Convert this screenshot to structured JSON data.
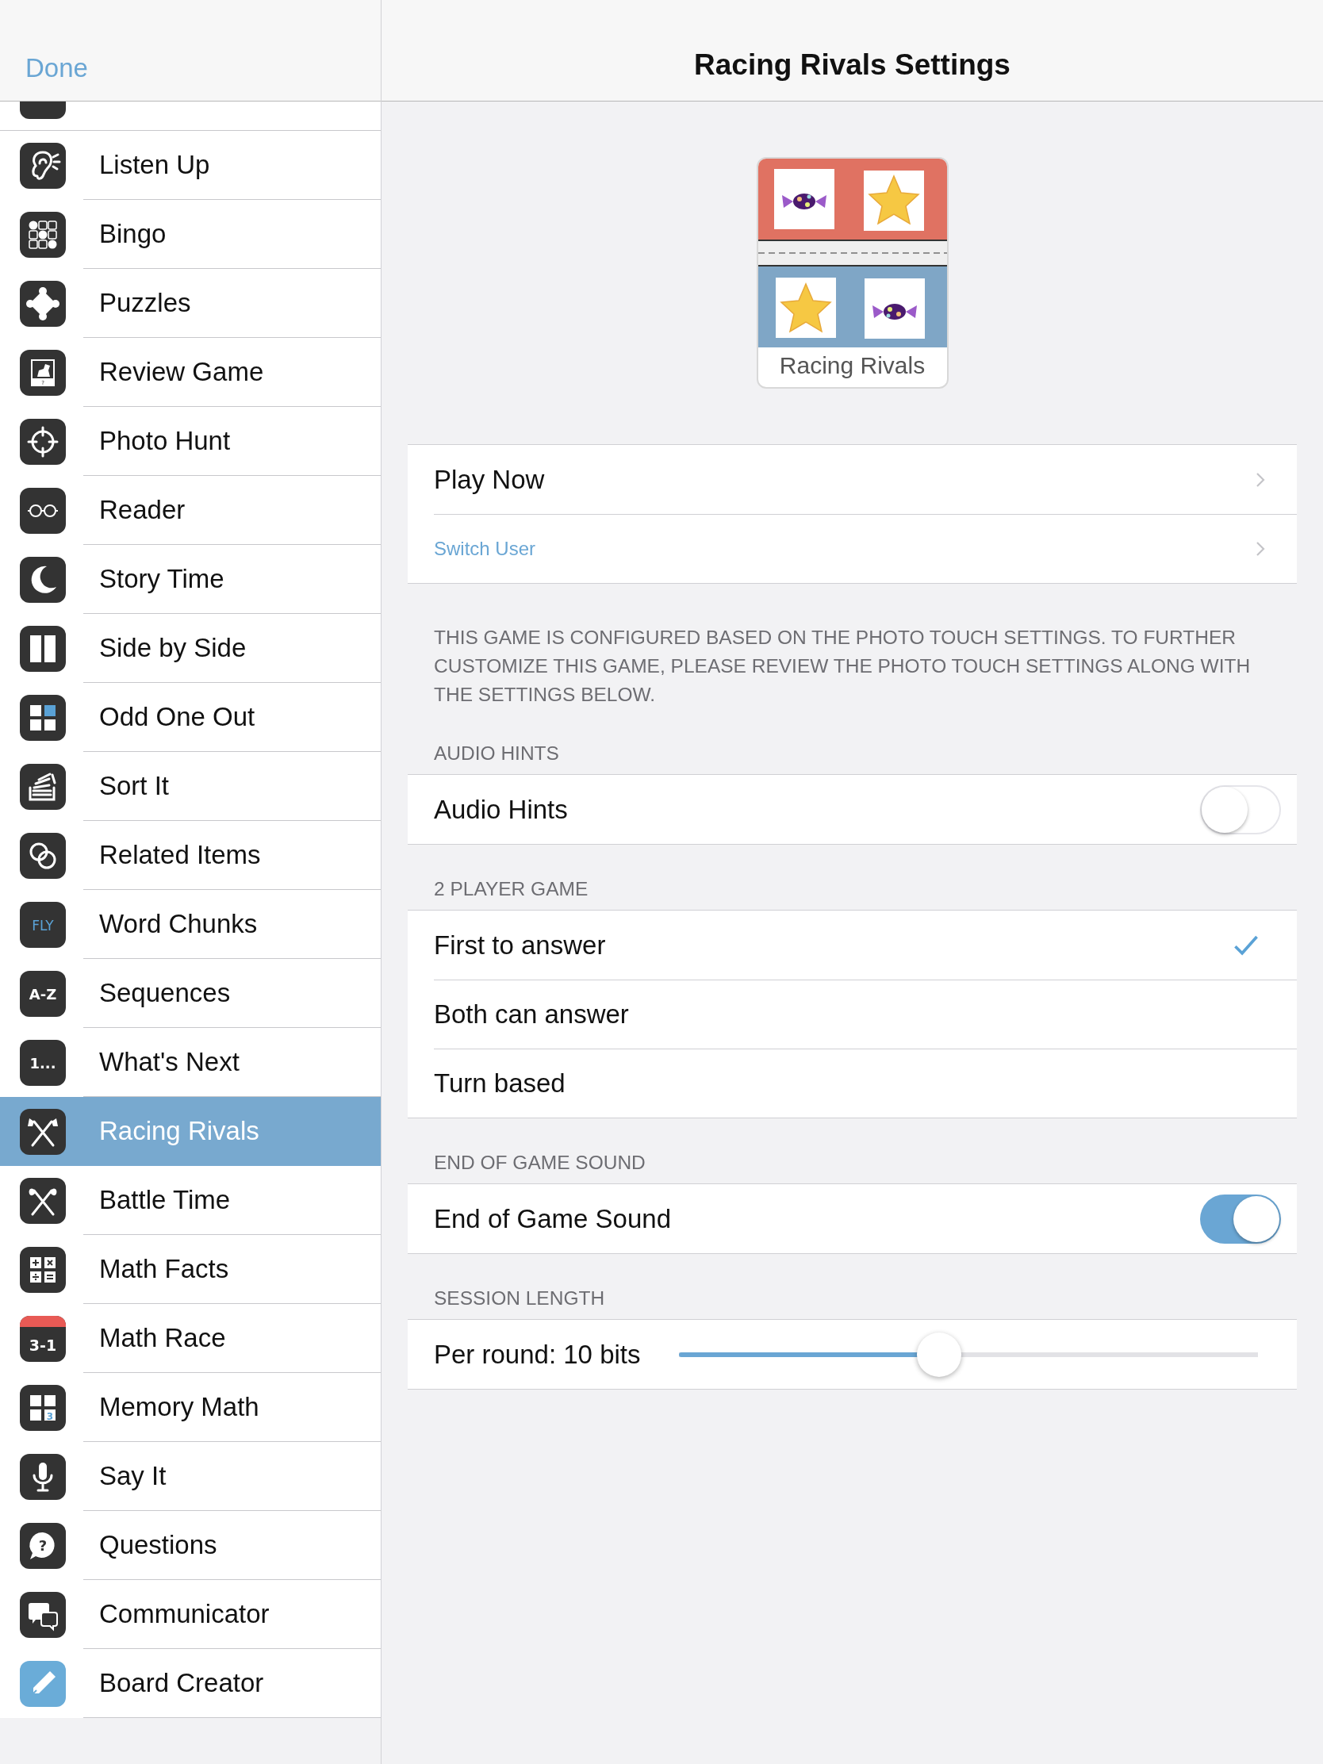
{
  "sidebar": {
    "done_button": "Done",
    "items": [
      {
        "label": "Listen Up",
        "selected": false
      },
      {
        "label": "Bingo",
        "selected": false
      },
      {
        "label": "Puzzles",
        "selected": false
      },
      {
        "label": "Review Game",
        "selected": false,
        "icon_text": "?"
      },
      {
        "label": "Photo Hunt",
        "selected": false
      },
      {
        "label": "Reader",
        "selected": false
      },
      {
        "label": "Story Time",
        "selected": false
      },
      {
        "label": "Side by Side",
        "selected": false
      },
      {
        "label": "Odd One Out",
        "selected": false
      },
      {
        "label": "Sort It",
        "selected": false
      },
      {
        "label": "Related Items",
        "selected": false
      },
      {
        "label": "Word Chunks",
        "selected": false,
        "icon_text": "FLY"
      },
      {
        "label": "Sequences",
        "selected": false,
        "icon_text": "A-Z"
      },
      {
        "label": "What's Next",
        "selected": false,
        "icon_text": "1..."
      },
      {
        "label": "Racing Rivals",
        "selected": true
      },
      {
        "label": "Battle Time",
        "selected": false
      },
      {
        "label": "Math Facts",
        "selected": false
      },
      {
        "label": "Math Race",
        "selected": false,
        "icon_text": "3-1"
      },
      {
        "label": "Memory Math",
        "selected": false,
        "icon_text": "3"
      },
      {
        "label": "Say It",
        "selected": false
      },
      {
        "label": "Questions",
        "selected": false,
        "icon_text": "?"
      },
      {
        "label": "Communicator",
        "selected": false
      },
      {
        "label": "Board Creator",
        "selected": false
      }
    ]
  },
  "header": {
    "title": "Racing Rivals Settings"
  },
  "game_tile": {
    "label": "Racing Rivals"
  },
  "actions": [
    {
      "label": "Play Now",
      "kind": "primary"
    },
    {
      "label": "Switch User",
      "kind": "link"
    }
  ],
  "note": "THIS GAME IS CONFIGURED BASED ON THE PHOTO TOUCH SETTINGS. TO FURTHER CUSTOMIZE THIS GAME, PLEASE REVIEW THE PHOTO TOUCH SETTINGS ALONG WITH THE SETTINGS BELOW.",
  "sections": [
    {
      "header": "AUDIO HINTS",
      "rows": [
        {
          "kind": "toggle",
          "label": "Audio Hints",
          "on": false
        }
      ]
    },
    {
      "header": "2 PLAYER GAME",
      "rows": [
        {
          "kind": "option",
          "label": "First to answer",
          "selected": true
        },
        {
          "kind": "option",
          "label": "Both can answer",
          "selected": false
        },
        {
          "kind": "option",
          "label": "Turn based",
          "selected": false
        }
      ]
    },
    {
      "header": "END OF GAME SOUND",
      "rows": [
        {
          "kind": "toggle",
          "label": "End of Game Sound",
          "on": true
        }
      ]
    },
    {
      "header": "SESSION LENGTH",
      "rows": [
        {
          "kind": "slider",
          "label": "Per round: 10 bits",
          "level": 0.45
        }
      ]
    }
  ]
}
